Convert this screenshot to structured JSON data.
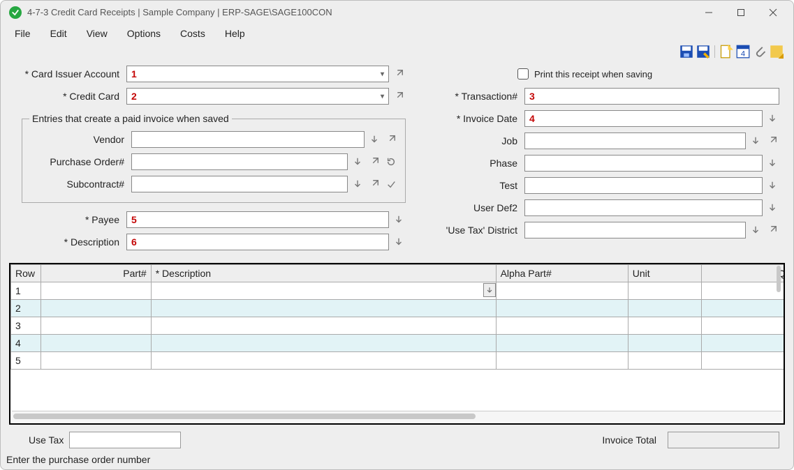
{
  "window": {
    "title": "4-7-3 Credit Card Receipts  |  Sample Company  |  ERP-SAGE\\SAGE100CON"
  },
  "menu": {
    "items": [
      "File",
      "Edit",
      "View",
      "Options",
      "Costs",
      "Help"
    ]
  },
  "toolbar": {
    "icons": [
      "save-icon",
      "save-as-icon",
      "new-icon",
      "form-icon",
      "attach-icon",
      "note-icon"
    ]
  },
  "form": {
    "left": {
      "card_issuer_label": "* Card Issuer Account",
      "card_issuer_value": "1",
      "credit_card_label": "* Credit Card",
      "credit_card_value": "2",
      "group_legend": "Entries that create a paid invoice when saved",
      "vendor_label": "Vendor",
      "vendor_value": "",
      "po_label": "Purchase Order#",
      "po_value": "",
      "subcontract_label": "Subcontract#",
      "subcontract_value": "",
      "payee_label": "* Payee",
      "payee_value": "5",
      "description_label": "* Description",
      "description_value": "6"
    },
    "right": {
      "print_label": "Print this receipt when saving",
      "transaction_label": "* Transaction#",
      "transaction_value": "3",
      "invoice_date_label": "* Invoice Date",
      "invoice_date_value": "4",
      "job_label": "Job",
      "job_value": "",
      "phase_label": "Phase",
      "phase_value": "",
      "test_label": "Test",
      "test_value": "",
      "userdef2_label": "User Def2",
      "userdef2_value": "",
      "usetax_district_label": "'Use Tax' District",
      "usetax_district_value": ""
    }
  },
  "grid": {
    "columns": [
      "Row",
      "Part#",
      "* Description",
      "Alpha Part#",
      "Unit",
      "Quantity"
    ],
    "rows": [
      "1",
      "2",
      "3",
      "4",
      "5"
    ]
  },
  "footer": {
    "use_tax_label": "Use Tax",
    "use_tax_value": "",
    "invoice_total_label": "Invoice Total",
    "invoice_total_value": ""
  },
  "status": {
    "text": "Enter the purchase order number"
  }
}
